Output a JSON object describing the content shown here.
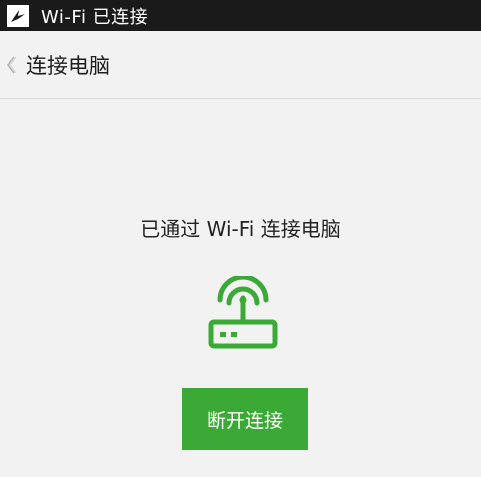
{
  "status_bar": {
    "title": "Wi-Fi 已连接",
    "app_icon": "bird-logo-icon"
  },
  "nav": {
    "back_icon": "chevron-left-icon",
    "title": "连接电脑"
  },
  "main": {
    "message": "已通过 Wi-Fi 连接电脑",
    "icon": "wifi-router-icon",
    "disconnect_label": "断开连接"
  },
  "colors": {
    "accent": "#3ba935",
    "status_bar_bg": "#1a1a1a",
    "background": "#f2f2f2"
  }
}
